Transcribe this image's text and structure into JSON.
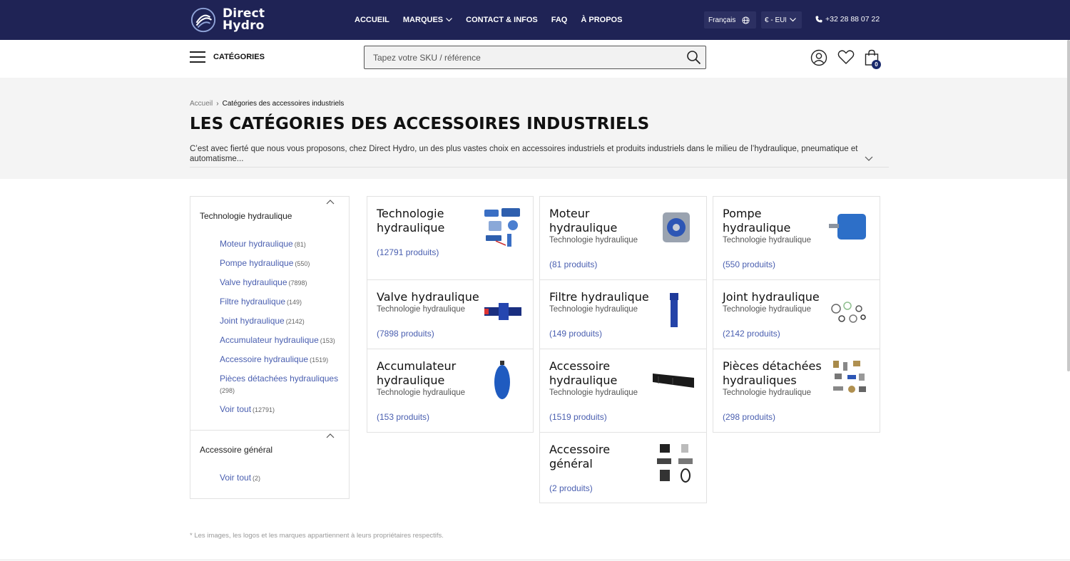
{
  "header": {
    "logo_line1": "Direct",
    "logo_line2": "Hydro",
    "nav": [
      "ACCUEIL",
      "MARQUES",
      "CONTACT & INFOS",
      "FAQ",
      "À PROPOS"
    ],
    "language": "Français",
    "currency": "€ - EUR",
    "phone": "+32 28 88 07 22"
  },
  "subbar": {
    "categories_label": "CATÉGORIES",
    "search_placeholder": "Tapez votre SKU / référence",
    "cart_count": "0"
  },
  "breadcrumb": {
    "home": "Accueil",
    "current": "Catégories des accessoires industriels"
  },
  "page": {
    "title": "LES CATÉGORIES DES ACCESSOIRES INDUSTRIELS",
    "intro": "C’est avec fierté que nous vous proposons, chez Direct Hydro, un des plus vastes choix en accessoires industriels et produits industriels dans le milieu de l’hydraulique, pneumatique et automatisme..."
  },
  "sidebar": {
    "sections": [
      {
        "title": "Technologie hydraulique",
        "items": [
          {
            "label": "Moteur hydraulique",
            "count": "(81)"
          },
          {
            "label": "Pompe hydraulique",
            "count": "(550)"
          },
          {
            "label": "Valve hydraulique",
            "count": "(7898)"
          },
          {
            "label": "Filtre hydraulique",
            "count": "(149)"
          },
          {
            "label": "Joint hydraulique",
            "count": "(2142)"
          },
          {
            "label": "Accumulateur hydraulique",
            "count": "(153)"
          },
          {
            "label": "Accessoire hydraulique",
            "count": "(1519)"
          },
          {
            "label": "Pièces détachées hydrauliques",
            "count": "(298)"
          },
          {
            "label": "Voir tout",
            "count": "(12791)"
          }
        ]
      },
      {
        "title": "Accessoire général",
        "items": [
          {
            "label": "Voir tout",
            "count": "(2)"
          }
        ]
      }
    ]
  },
  "cards": [
    {
      "title": "Technologie hydraulique",
      "subtitle": "",
      "count": "(12791 produits)"
    },
    {
      "title": "Moteur hydraulique",
      "subtitle": "Technologie hydraulique",
      "count": "(81 produits)"
    },
    {
      "title": "Pompe hydraulique",
      "subtitle": "Technologie hydraulique",
      "count": "(550 produits)"
    },
    {
      "title": "Valve hydraulique",
      "subtitle": "Technologie hydraulique",
      "count": "(7898 produits)"
    },
    {
      "title": "Filtre hydraulique",
      "subtitle": "Technologie hydraulique",
      "count": "(149 produits)"
    },
    {
      "title": "Joint hydraulique",
      "subtitle": "Technologie hydraulique",
      "count": "(2142 produits)"
    },
    {
      "title": "Accumulateur hydraulique",
      "subtitle": "Technologie hydraulique",
      "count": "(153 produits)"
    },
    {
      "title": "Accessoire hydraulique",
      "subtitle": "Technologie hydraulique",
      "count": "(1519 produits)"
    },
    {
      "title": "Pièces détachées hydrauliques",
      "subtitle": "Technologie hydraulique",
      "count": "(298 produits)"
    },
    {
      "title": "Accessoire général",
      "subtitle": "",
      "count": "(2 produits)"
    }
  ],
  "footnote": "* Les images, les logos et les marques appartiennent à leurs propriétaires respectifs.",
  "colors": {
    "topbar": "#1f2355",
    "link": "#4a5fb0",
    "badge": "#1a2a6c"
  }
}
